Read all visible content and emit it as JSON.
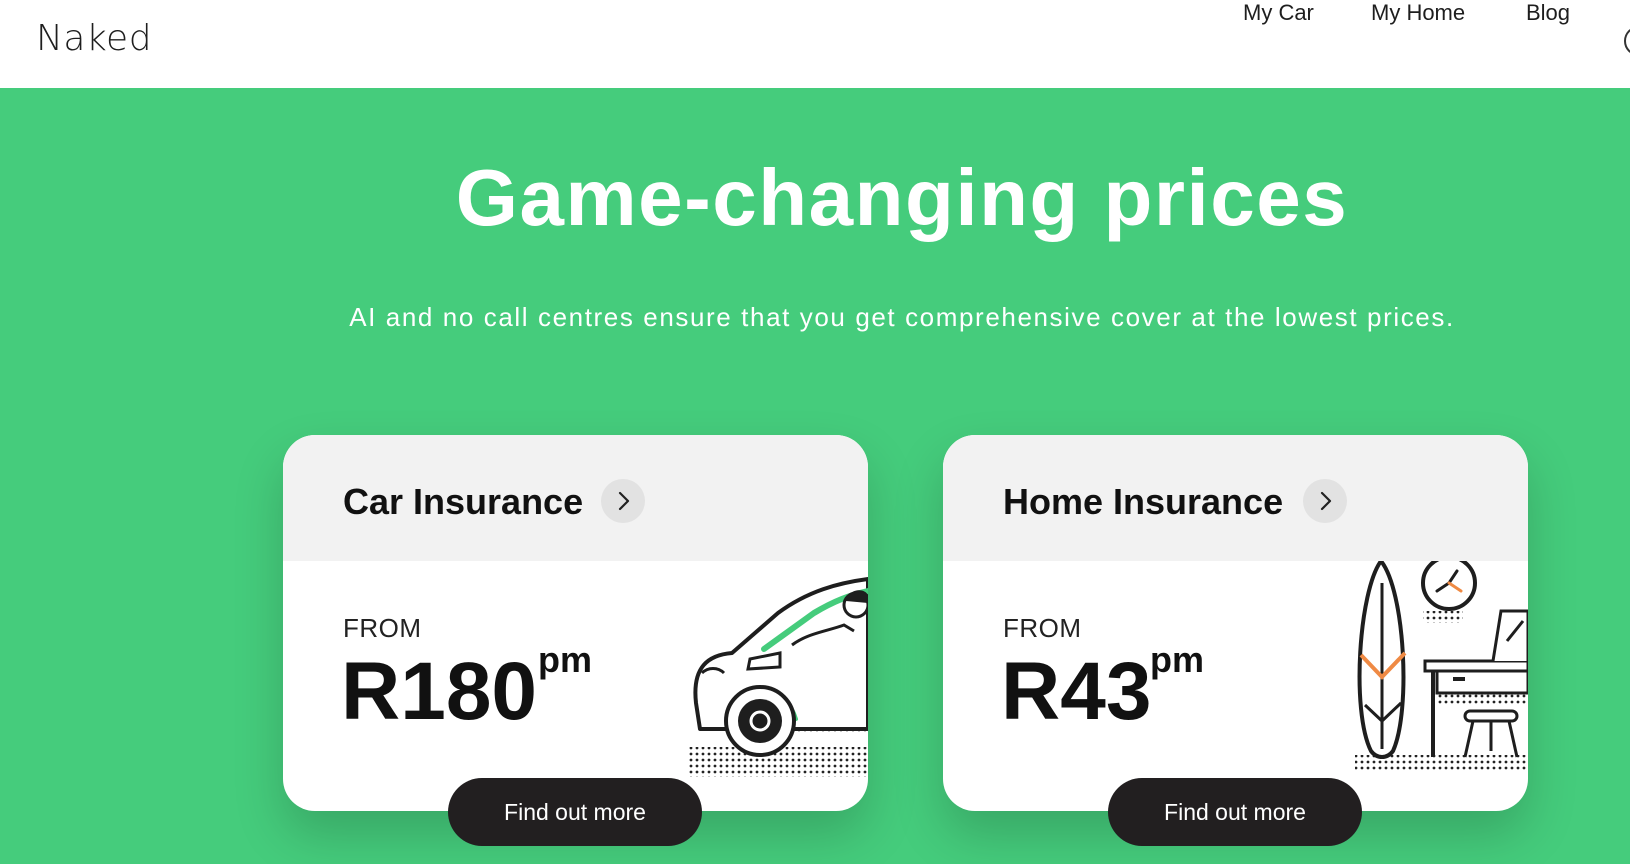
{
  "header": {
    "logo": "Naked",
    "nav": [
      {
        "label": "My Car"
      },
      {
        "label": "My Home"
      },
      {
        "label": "Blog"
      }
    ]
  },
  "hero": {
    "title": "Game-changing prices",
    "subtitle": "AI and no call centres ensure that you get comprehensive cover at the lowest prices."
  },
  "cards": [
    {
      "title": "Car Insurance",
      "from_label": "FROM",
      "price": "R180",
      "unit": "pm",
      "cta": "Find out more"
    },
    {
      "title": "Home Insurance",
      "from_label": "FROM",
      "price": "R43",
      "unit": "pm",
      "cta": "Find out more"
    }
  ],
  "colors": {
    "brand_green": "#45cc7c",
    "accent_orange": "#ef8a44",
    "button_dark": "#221f20"
  },
  "icons": {
    "card_link": "chevron-right-icon",
    "car_illustration": "car-driver-illustration",
    "home_illustration": "surfboard-desk-illustration"
  }
}
